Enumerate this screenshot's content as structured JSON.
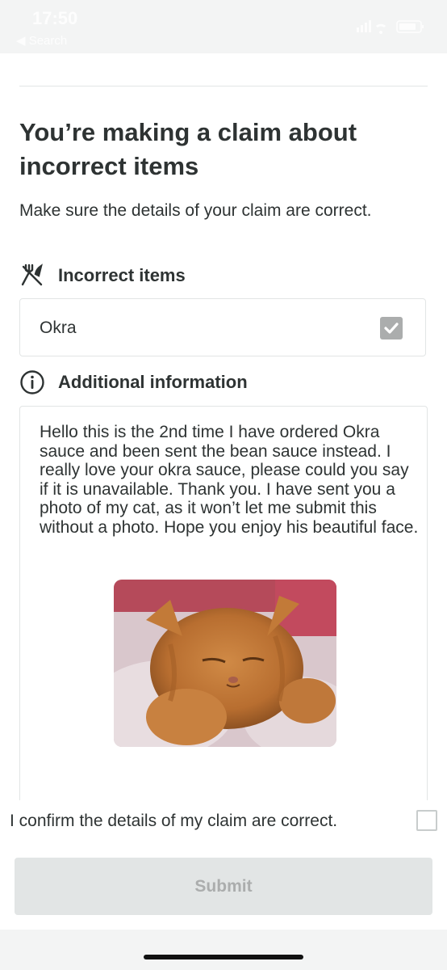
{
  "status_bar": {
    "time": "17:50",
    "back_label": "◀ Search"
  },
  "claim": {
    "title": "You’re making a claim about incorrect items",
    "subtitle": "Make sure the details of your claim are correct."
  },
  "incorrect_items": {
    "heading": "Incorrect items",
    "icon": "cutlery-crossed-icon",
    "items": [
      {
        "name": "Okra",
        "checked": true
      }
    ]
  },
  "additional_info": {
    "heading": "Additional information",
    "icon": "info-circle-icon",
    "text": "Hello this is the 2nd time I have ordered Okra sauce and been sent the bean sauce instead. I really love your okra sauce, please could you say if it is unavailable. Thank you. I have sent you a photo of my cat, as it won’t let me submit this without a photo. Hope you enjoy his beautiful face.",
    "attachment": "cat-photo"
  },
  "confirm": {
    "label": "I confirm the details of my claim are correct.",
    "checked": false
  },
  "submit": {
    "label": "Submit",
    "enabled": false
  },
  "colors": {
    "text": "#2e3333",
    "border": "#e2e5e5",
    "disabled_bg": "#e2e5e5",
    "disabled_text": "#abadad"
  }
}
